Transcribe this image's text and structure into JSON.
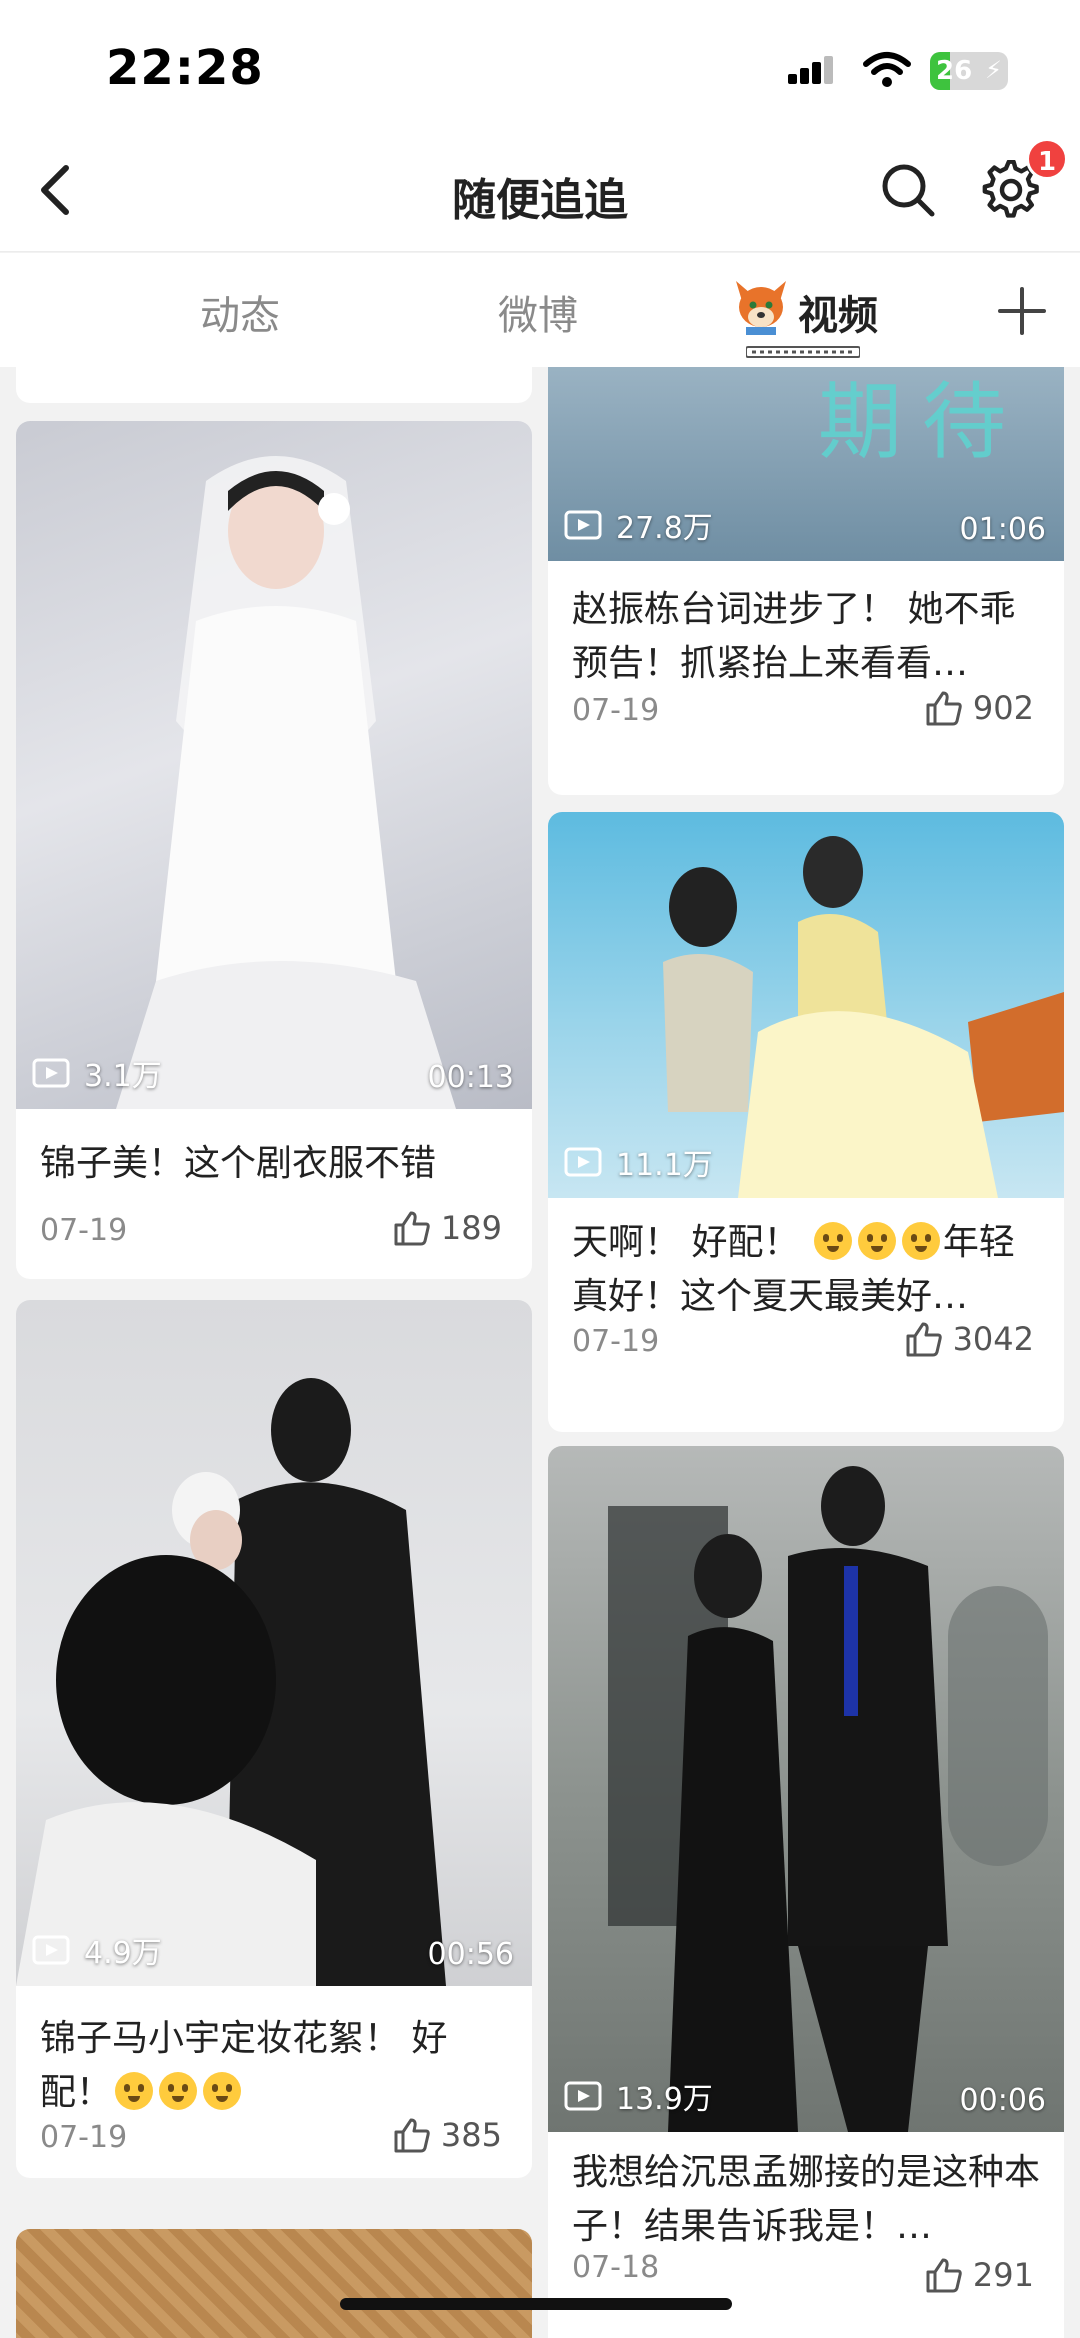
{
  "status_bar": {
    "time": "22:28",
    "battery": "26",
    "battery_level": 0.26
  },
  "header": {
    "title": "随便追追",
    "settings_badge": "1"
  },
  "tabs": [
    {
      "label": "动态",
      "active": false
    },
    {
      "label": "微博",
      "active": false
    },
    {
      "label": "视频",
      "active": true
    }
  ],
  "cards": [
    {
      "views": "3.1万",
      "duration": "00:13",
      "title": "锦子美！这个剧衣服不错",
      "date": "07-19",
      "likes": "189"
    },
    {
      "views": "4.9万",
      "duration": "00:56",
      "title": "锦子马小宇定妆花絮！ 好配！",
      "emoji_count": 3,
      "date": "07-19",
      "likes": "385"
    },
    {
      "overlay_text": "期待",
      "views": "27.8万",
      "duration": "01:06",
      "title": "赵振栋台词进步了！ 她不乖预告！抓紧抬上来看看…",
      "date": "07-19",
      "likes": "902"
    },
    {
      "views": "11.1万",
      "title_lead": "天啊！ 好配！ ",
      "emoji_count": 3,
      "title_tail": "年轻真好！这个夏天最美好…",
      "date": "07-19",
      "likes": "3042"
    },
    {
      "views": "13.9万",
      "duration": "00:06",
      "title": "我想给沉思孟娜接的是这种本子！结果告诉我是！…",
      "date": "07-18",
      "likes": "291"
    }
  ],
  "colors": {
    "badge": "#f0413f",
    "accent_tab": "#222222",
    "inactive_tab": "#8a8a8a"
  }
}
